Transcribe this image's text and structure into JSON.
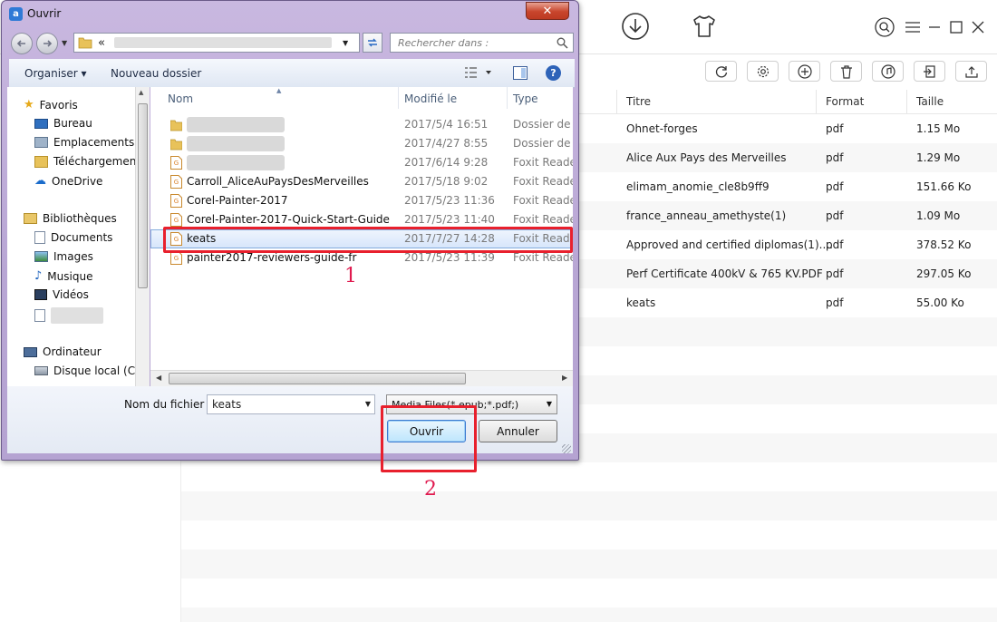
{
  "app": {
    "columns": {
      "title": "Titre",
      "format": "Format",
      "size": "Taille"
    },
    "rows": [
      {
        "title": "Ohnet-forges",
        "format": "pdf",
        "size": "1.15 Mo"
      },
      {
        "title": "Alice Aux Pays des Merveilles",
        "format": "pdf",
        "size": "1.29 Mo"
      },
      {
        "title": "elimam_anomie_cle8b9ff9",
        "format": "pdf",
        "size": "151.66 Ko"
      },
      {
        "title": "france_anneau_amethyste(1)",
        "format": "pdf",
        "size": "1.09 Mo"
      },
      {
        "title": "Approved and certified diplomas(1)....",
        "format": "pdf",
        "size": "378.52 Ko"
      },
      {
        "title": "Perf Certificate 400kV & 765 KV.PDF",
        "format": "pdf",
        "size": "297.05 Ko"
      },
      {
        "title": "keats",
        "format": "pdf",
        "size": "55.00 Ko"
      }
    ]
  },
  "dialog": {
    "title": "Ouvrir",
    "close_label": "✕",
    "address_prefix": "«",
    "search_placeholder": "Rechercher dans :",
    "organize_label": "Organiser ▾",
    "new_folder_label": "Nouveau dossier",
    "nav": {
      "favorites_label": "Favoris",
      "favorites": [
        "Bureau",
        "Emplacements ré",
        "Téléchargements",
        "OneDrive"
      ],
      "libraries_label": "Bibliothèques",
      "libraries": [
        "Documents",
        "Images",
        "Musique",
        "Vidéos"
      ],
      "computer_label": "Ordinateur",
      "computer": [
        "Disque local (C:)"
      ]
    },
    "file_columns": {
      "name": "Nom",
      "modified": "Modifié le",
      "type": "Type"
    },
    "files": [
      {
        "name": "",
        "modified": "2017/5/4 16:51",
        "type": "Dossier de fi"
      },
      {
        "name": "",
        "modified": "2017/4/27 8:55",
        "type": "Dossier de fi"
      },
      {
        "name": "",
        "modified": "2017/6/14 9:28",
        "type": "Foxit Reader"
      },
      {
        "name": "Carroll_AliceAuPaysDesMerveilles",
        "modified": "2017/5/18 9:02",
        "type": "Foxit Reader"
      },
      {
        "name": "Corel-Painter-2017",
        "modified": "2017/5/23 11:36",
        "type": "Foxit Reader"
      },
      {
        "name": "Corel-Painter-2017-Quick-Start-Guide",
        "modified": "2017/5/23 11:40",
        "type": "Foxit Reader"
      },
      {
        "name": "keats",
        "modified": "2017/7/27 14:28",
        "type": "Foxit Reader"
      },
      {
        "name": "painter2017-reviewers-guide-fr",
        "modified": "2017/5/23 11:39",
        "type": "Foxit Reader"
      }
    ],
    "filename_label": "Nom du fichier :",
    "filename_value": "keats",
    "filter_value": "Media Files(*.epub;*.pdf;)",
    "open_label": "Ouvrir",
    "cancel_label": "Annuler"
  },
  "annotations": {
    "step1": "1",
    "step2": "2",
    "color": "#e8202d"
  }
}
